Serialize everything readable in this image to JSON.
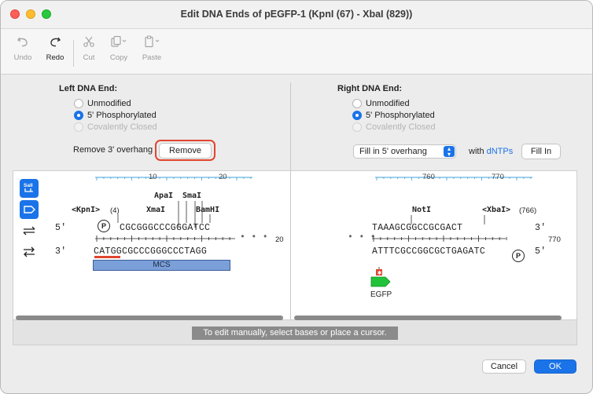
{
  "window": {
    "title": "Edit DNA Ends of pEGFP-1 (KpnI (67) - XbaI (829))"
  },
  "toolbar": {
    "undo": "Undo",
    "redo": "Redo",
    "cut": "Cut",
    "copy": "Copy",
    "paste": "Paste"
  },
  "left_end": {
    "title": "Left DNA End:",
    "options": [
      "Unmodified",
      "5' Phosphorylated",
      "Covalently Closed"
    ],
    "selected": "5' Phosphorylated",
    "remove_label": "Remove 3' overhang",
    "remove_button": "Remove"
  },
  "right_end": {
    "title": "Right DNA End:",
    "options": [
      "Unmodified",
      "5' Phosphorylated",
      "Covalently Closed"
    ],
    "selected": "5' Phosphorylated",
    "fill_select": "Fill in 5' overhang",
    "with_label": "with",
    "dntps": "dNTPs",
    "fill_button": "Fill In"
  },
  "side_tools": {
    "sali_icon_text": "SalI"
  },
  "left_seq": {
    "ruler_ticks": [
      "10",
      "20"
    ],
    "enzymes": {
      "kpni": "<KpnI>",
      "kpni_pos": "(4)",
      "apai": "ApaI",
      "smai": "SmaI",
      "xmai": "XmaI",
      "bamhi": "BamHI"
    },
    "top_label": "5'",
    "top": "CGCGGGCCCGGGATCC",
    "bottom_label": "3'",
    "bottom": "CATGGCGCCCGGGCCCTAGG",
    "right_num": "20",
    "feature": "MCS",
    "phospho": "P"
  },
  "right_seq": {
    "ruler_ticks": [
      "760",
      "770"
    ],
    "enzymes": {
      "noti": "NotI",
      "xbai": "<XbaI>",
      "xbai_pos": "(766)"
    },
    "top": "TAAAGCGGCCGCGACT",
    "top_label": "3'",
    "bottom": "ATTTCGCCGGCGCTGAGATC",
    "bottom_label": "5'",
    "right_num": "770",
    "feature": "EGFP",
    "phospho": "P"
  },
  "status": {
    "message": "To edit manually, select bases or place a cursor."
  },
  "footer": {
    "cancel": "Cancel",
    "ok": "OK"
  },
  "colors": {
    "accent": "#1a73e8",
    "highlight": "#e0452e",
    "mcs_fill": "#7b9fd8",
    "egfp_fill": "#22c33a",
    "ruler": "#3fa0d9"
  }
}
